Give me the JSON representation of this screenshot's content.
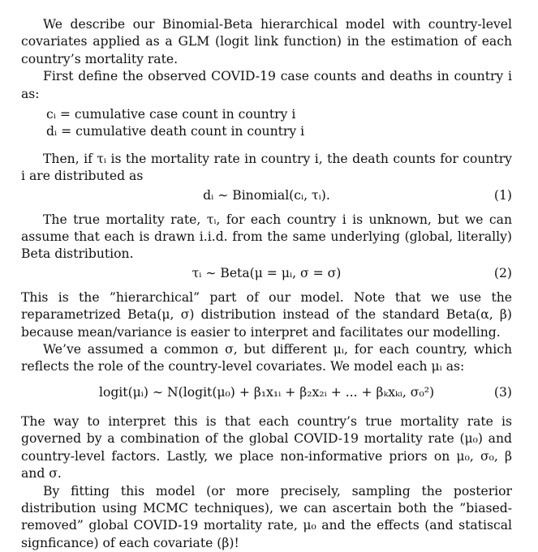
{
  "paragraphs": {
    "p1": "We describe our Binomial-Beta hierarchical model with country-level covariates applied as a GLM (logit link function) in the estimation of each country’s mortality rate.",
    "p2": "First define the observed COVID-19 case counts and deaths in country i as:",
    "def1": "cᵢ = cumulative case count in country i",
    "def2": "dᵢ = cumulative death count in country i",
    "p3": "Then, if τᵢ is the mortality rate in country i, the death counts for country i are distributed as",
    "eq1": "dᵢ ∼ Binomial(cᵢ, τᵢ).",
    "eq1_num": "(1)",
    "p4": "The true mortality rate, τᵢ, for each country i is unknown, but we can assume that each is drawn i.i.d.  from the same underlying (global, literally) Beta distribution.",
    "eq2": "τᵢ ∼ Beta(μ = μᵢ, σ = σ)",
    "eq2_num": "(2)",
    "p5": "This is the ”hierarchical” part of our model. Note that we use the reparametrized Beta(μ, σ) distribution instead of the standard Beta(α, β) because mean/variance is easier to interpret and facilitates our modelling.",
    "p6": "We’ve assumed a common σ, but different μᵢ, for each country, which reflects the role of the country-level covariates. We model each μᵢ as:",
    "eq3": "logit(μᵢ) ∼ N(logit(μ₀) + β₁x₁ᵢ + β₂x₂ᵢ + ... + βₖxₖᵢ, σ₀²)",
    "eq3_num": "(3)",
    "p7": "The way to interpret this is that each country’s true mortality rate is governed by a combination of the global COVID-19 mortality rate (μ₀) and country-level factors. Lastly, we place non-informative priors on μ₀, σ₀, β and σ.",
    "p8": "By fitting this model (or more precisely, sampling the posterior distribution using MCMC techniques), we can ascertain both the ”biased-removed” global COVID-19 mortality rate, μ₀ and the effects (and statiscal signficance) of each covariate (β)!"
  }
}
